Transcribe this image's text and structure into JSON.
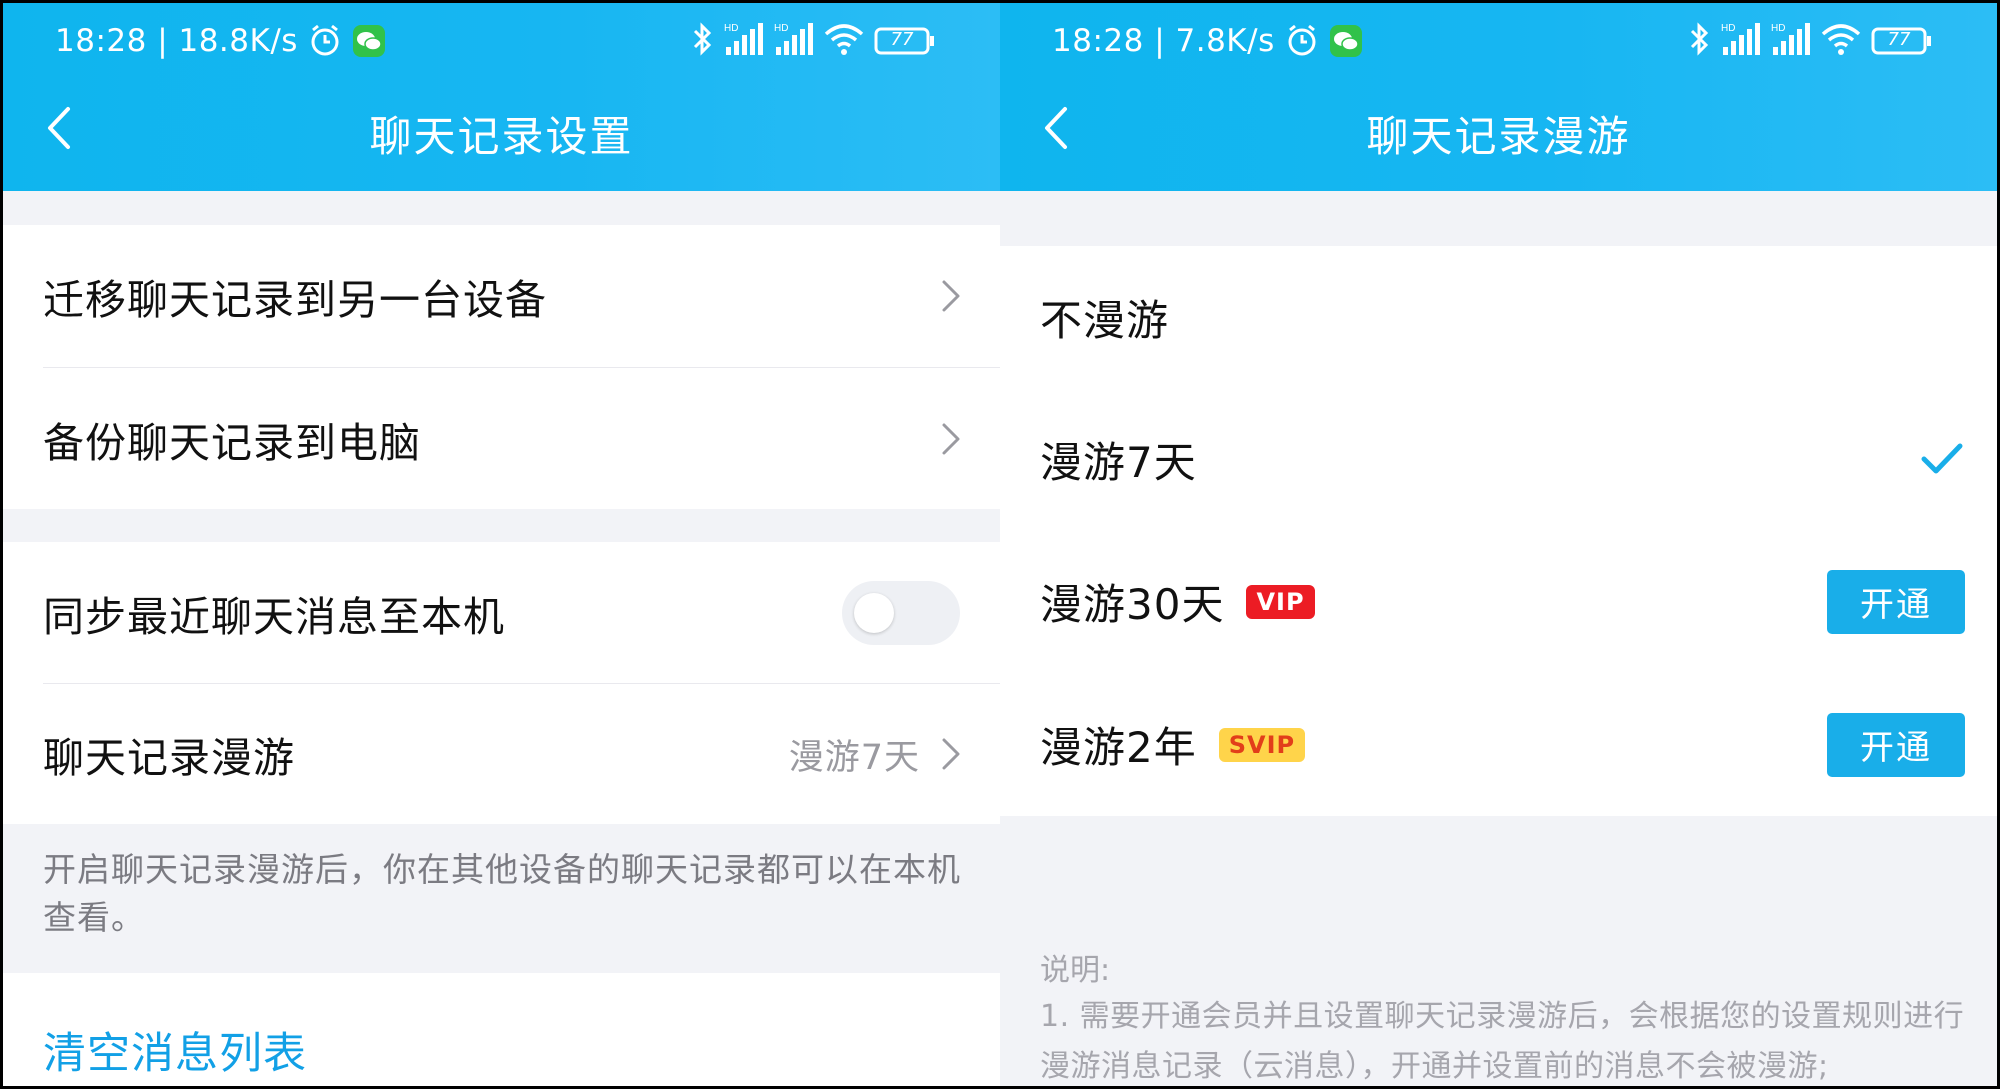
{
  "left": {
    "status": {
      "time": "18:28 | 18.8K/s",
      "battery": "77"
    },
    "title": "聊天记录设置",
    "items": {
      "migrate": "迁移聊天记录到另一台设备",
      "backup": "备份聊天记录到电脑",
      "sync": "同步最近聊天消息至本机",
      "roaming": "聊天记录漫游",
      "roaming_value": "漫游7天"
    },
    "hint": "开启聊天记录漫游后，你在其他设备的聊天记录都可以在本机查看。",
    "clear_link": "清空消息列表",
    "sync_toggle_on": false
  },
  "right": {
    "status": {
      "time": "18:28 | 7.8K/s",
      "battery": "77"
    },
    "title": "聊天记录漫游",
    "options": [
      {
        "label": "不漫游"
      },
      {
        "label": "漫游7天",
        "selected": true
      },
      {
        "label": "漫游30天",
        "badge": "VIP",
        "button": "开通"
      },
      {
        "label": "漫游2年",
        "badge": "SVIP",
        "button": "开通"
      }
    ],
    "note_title": "说明:",
    "note_text": "1. 需要开通会员并且设置聊天记录漫游后，会根据您的设置规则进行漫游消息记录（云消息），开通并设置前的消息不会被漫游;"
  },
  "colors": {
    "header": "#17b6f2",
    "accent": "#19aee9",
    "link": "#12a0e6",
    "vip": "#ec1c24",
    "svip": "#ffd44a"
  },
  "icons": [
    "back-arrow-icon",
    "chevron-right-icon",
    "checkmark-icon",
    "alarm-icon",
    "wechat-icon",
    "bluetooth-icon",
    "signal-icon",
    "wifi-icon",
    "battery-icon"
  ]
}
